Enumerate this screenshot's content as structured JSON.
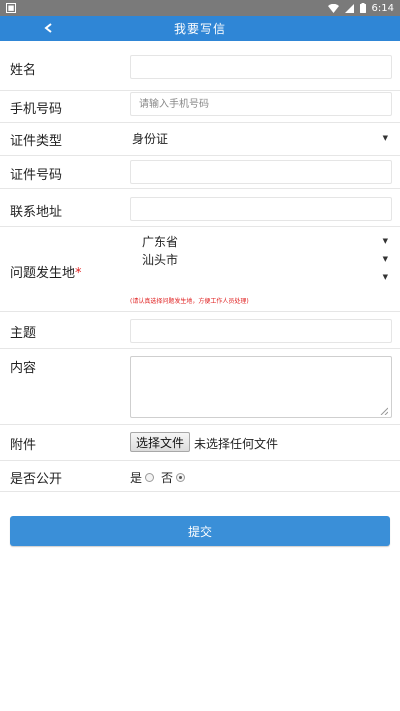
{
  "status_bar": {
    "time": "6:14",
    "app_icon": "notification-app-icon",
    "icons": [
      "wifi-icon",
      "signal-icon",
      "battery-icon"
    ]
  },
  "header": {
    "back_glyph": "<",
    "title": "我要写信",
    "color": "#2f86d6"
  },
  "form": {
    "name": {
      "label": "姓名",
      "value": ""
    },
    "phone": {
      "label": "手机号码",
      "placeholder": "请输入手机号码"
    },
    "id_type": {
      "label": "证件类型",
      "selected": "身份证"
    },
    "id_number": {
      "label": "证件号码",
      "value": ""
    },
    "address": {
      "label": "联系地址",
      "value": ""
    },
    "location": {
      "label": "问题发生地",
      "required_mark": "*",
      "province": "广东省",
      "city": "汕头市",
      "district": "",
      "hint": "(请认真选择问题发生地，方便工作人员处理)"
    },
    "subject": {
      "label": "主题",
      "value": ""
    },
    "content": {
      "label": "内容",
      "value": ""
    },
    "attachment": {
      "label": "附件",
      "button_label": "选择文件",
      "status": "未选择任何文件"
    },
    "public": {
      "label": "是否公开",
      "yes_label": "是",
      "no_label": "否",
      "selected": "no"
    }
  },
  "submit": {
    "label": "提交",
    "color": "#3a8fd8"
  }
}
